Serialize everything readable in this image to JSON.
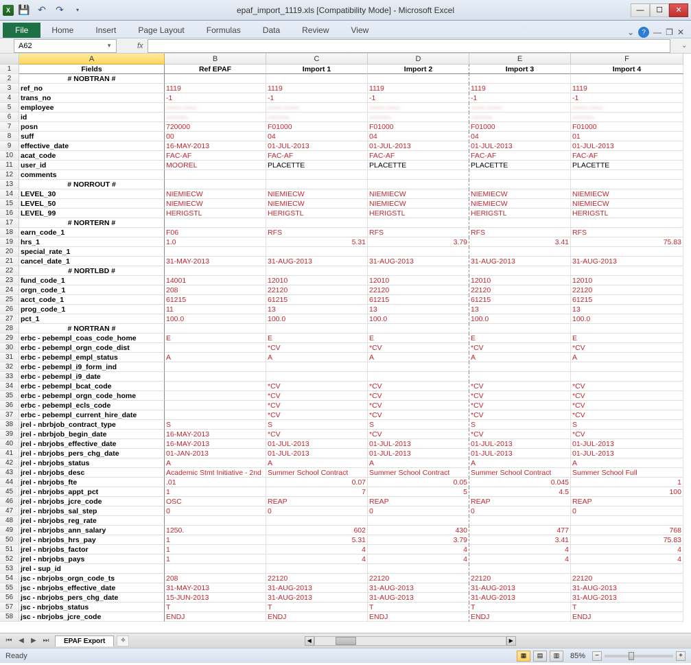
{
  "app": {
    "title": "epaf_import_1119.xls  [Compatibility Mode] - Microsoft Excel"
  },
  "ribbon": {
    "file": "File",
    "tabs": [
      "Home",
      "Insert",
      "Page Layout",
      "Formulas",
      "Data",
      "Review",
      "View"
    ]
  },
  "namebox": "A62",
  "fx": "fx",
  "cols": [
    "A",
    "B",
    "C",
    "D",
    "E",
    "F"
  ],
  "headers": [
    "Fields",
    "Ref EPAF",
    "Import 1",
    "Import 2",
    "Import 3",
    "Import 4"
  ],
  "rows": [
    {
      "n": 1,
      "type": "hdr",
      "c": [
        "Fields",
        "Ref EPAF",
        "Import 1",
        "Import 2",
        "Import 3",
        "Import 4"
      ]
    },
    {
      "n": 2,
      "type": "section",
      "c": [
        "# NOBTRAN #",
        "",
        "",
        "",
        "",
        ""
      ]
    },
    {
      "n": 3,
      "c": [
        "ref_no",
        "1119",
        "1119",
        "1119",
        "1119",
        "1119"
      ]
    },
    {
      "n": 4,
      "c": [
        "trans_no",
        "-1",
        "-1",
        "-1",
        "-1",
        "-1"
      ]
    },
    {
      "n": 5,
      "blur": true,
      "c": [
        "employee",
        "—— ——",
        "—— ——",
        "—— ——",
        "—— ——",
        "—— ——"
      ]
    },
    {
      "n": 6,
      "blur": true,
      "c": [
        "id",
        "———",
        "———",
        "———",
        "———",
        "———"
      ]
    },
    {
      "n": 7,
      "c": [
        "posn",
        "720000",
        "F01000",
        "F01000",
        "F01000",
        "F01000"
      ]
    },
    {
      "n": 8,
      "c": [
        "suff",
        "00",
        "04",
        "04",
        "04",
        "01"
      ]
    },
    {
      "n": 9,
      "c": [
        "effective_date",
        "16-MAY-2013",
        "01-JUL-2013",
        "01-JUL-2013",
        "01-JUL-2013",
        "01-JUL-2013"
      ]
    },
    {
      "n": 10,
      "c": [
        "acat_code",
        "FAC-AF",
        "FAC-AF",
        "FAC-AF",
        "FAC-AF",
        "FAC-AF"
      ]
    },
    {
      "n": 11,
      "c": [
        "user_id",
        "MOOREL",
        "PLACETTE",
        "PLACETTE",
        "PLACETTE",
        "PLACETTE"
      ],
      "black": [
        2,
        3,
        4,
        5
      ]
    },
    {
      "n": 12,
      "c": [
        "comments",
        "",
        "",
        "",
        "",
        ""
      ]
    },
    {
      "n": 13,
      "type": "section",
      "c": [
        "# NORROUT #",
        "",
        "",
        "",
        "",
        ""
      ]
    },
    {
      "n": 14,
      "c": [
        "LEVEL_30",
        "NIEMIECW",
        "NIEMIECW",
        "NIEMIECW",
        "NIEMIECW",
        "NIEMIECW"
      ]
    },
    {
      "n": 15,
      "c": [
        "LEVEL_50",
        "NIEMIECW",
        "NIEMIECW",
        "NIEMIECW",
        "NIEMIECW",
        "NIEMIECW"
      ]
    },
    {
      "n": 16,
      "c": [
        "LEVEL_99",
        "HERIGSTL",
        "HERIGSTL",
        "HERIGSTL",
        "HERIGSTL",
        "HERIGSTL"
      ]
    },
    {
      "n": 17,
      "type": "section",
      "c": [
        "# NORTERN #",
        "",
        "",
        "",
        "",
        ""
      ]
    },
    {
      "n": 18,
      "c": [
        "earn_code_1",
        "F06",
        "RFS",
        "RFS",
        "RFS",
        "RFS"
      ]
    },
    {
      "n": 19,
      "c": [
        "hrs_1",
        "1.0",
        "5.31",
        "3.79",
        "3.41",
        "75.83"
      ],
      "num": [
        2,
        3,
        4,
        5
      ]
    },
    {
      "n": 20,
      "c": [
        "special_rate_1",
        "",
        "",
        "",
        "",
        ""
      ]
    },
    {
      "n": 21,
      "c": [
        "cancel_date_1",
        "31-MAY-2013",
        "31-AUG-2013",
        "31-AUG-2013",
        "31-AUG-2013",
        "31-AUG-2013"
      ]
    },
    {
      "n": 22,
      "type": "section",
      "c": [
        "# NORTLBD #",
        "",
        "",
        "",
        "",
        ""
      ]
    },
    {
      "n": 23,
      "c": [
        "fund_code_1",
        "14001",
        "12010",
        "12010",
        "12010",
        "12010"
      ]
    },
    {
      "n": 24,
      "c": [
        "orgn_code_1",
        "208",
        "22120",
        "22120",
        "22120",
        "22120"
      ]
    },
    {
      "n": 25,
      "c": [
        "acct_code_1",
        "61215",
        "61215",
        "61215",
        "61215",
        "61215"
      ]
    },
    {
      "n": 26,
      "c": [
        "prog_code_1",
        "11",
        "13",
        "13",
        "13",
        "13"
      ]
    },
    {
      "n": 27,
      "c": [
        "pct_1",
        "100.0",
        "100.0",
        "100.0",
        "100.0",
        "100.0"
      ]
    },
    {
      "n": 28,
      "type": "section",
      "c": [
        "# NORTRAN #",
        "",
        "",
        "",
        "",
        ""
      ]
    },
    {
      "n": 29,
      "c": [
        "erbc - pebempl_coas_code_home",
        "E",
        "E",
        "E",
        "E",
        "E"
      ]
    },
    {
      "n": 30,
      "c": [
        "erbc - pebempl_orgn_code_dist",
        "",
        "*CV",
        "*CV",
        "*CV",
        "*CV"
      ]
    },
    {
      "n": 31,
      "c": [
        "erbc - pebempl_empl_status",
        "A",
        "A",
        "A",
        "A",
        "A"
      ]
    },
    {
      "n": 32,
      "c": [
        "erbc - pebempl_i9_form_ind",
        "",
        "",
        "",
        "",
        ""
      ]
    },
    {
      "n": 33,
      "c": [
        "erbc - pebempl_i9_date",
        "",
        "",
        "",
        "",
        ""
      ]
    },
    {
      "n": 34,
      "c": [
        "erbc - pebempl_bcat_code",
        "",
        "*CV",
        "*CV",
        "*CV",
        "*CV"
      ]
    },
    {
      "n": 35,
      "c": [
        "erbc - pebempl_orgn_code_home",
        "",
        "*CV",
        "*CV",
        "*CV",
        "*CV"
      ]
    },
    {
      "n": 36,
      "c": [
        "erbc - pebempl_ecls_code",
        "",
        "*CV",
        "*CV",
        "*CV",
        "*CV"
      ]
    },
    {
      "n": 37,
      "c": [
        "erbc - pebempl_current_hire_date",
        "",
        "*CV",
        "*CV",
        "*CV",
        "*CV"
      ]
    },
    {
      "n": 38,
      "c": [
        "jrel - nbrbjob_contract_type",
        "S",
        "S",
        "S",
        "S",
        "S"
      ]
    },
    {
      "n": 39,
      "c": [
        "jrel - nbrbjob_begin_date",
        "16-MAY-2013",
        "*CV",
        "*CV",
        "*CV",
        "*CV"
      ]
    },
    {
      "n": 40,
      "c": [
        "jrel - nbrjobs_effective_date",
        "16-MAY-2013",
        "01-JUL-2013",
        "01-JUL-2013",
        "01-JUL-2013",
        "01-JUL-2013"
      ]
    },
    {
      "n": 41,
      "c": [
        "jrel - nbrjobs_pers_chg_date",
        "01-JAN-2013",
        "01-JUL-2013",
        "01-JUL-2013",
        "01-JUL-2013",
        "01-JUL-2013"
      ]
    },
    {
      "n": 42,
      "c": [
        "jrel - nbrjobs_status",
        "A",
        "A",
        "A",
        "A",
        "A"
      ]
    },
    {
      "n": 43,
      "c": [
        "jrel - nbrjobs_desc",
        "Academic Stmt Initiative - 2nd",
        "Summer School Contract",
        "Summer School Contract",
        "Summer School Contract",
        "Summer School Full"
      ]
    },
    {
      "n": 44,
      "c": [
        "jrel - nbrjobs_fte",
        ".01",
        "0.07",
        "0.05",
        "0.045",
        "1"
      ],
      "num": [
        2,
        3,
        4,
        5
      ]
    },
    {
      "n": 45,
      "c": [
        "jrel - nbrjobs_appt_pct",
        "1",
        "7",
        "5",
        "4.5",
        "100"
      ],
      "num": [
        2,
        3,
        4,
        5
      ]
    },
    {
      "n": 46,
      "c": [
        "jrel - nbrjobs_jcre_code",
        "OSC",
        "REAP",
        "REAP",
        "REAP",
        "REAP"
      ]
    },
    {
      "n": 47,
      "c": [
        "jrel - nbrjobs_sal_step",
        "0",
        "0",
        "0",
        "0",
        "0"
      ]
    },
    {
      "n": 48,
      "c": [
        "jrel - nbrjobs_reg_rate",
        "",
        "",
        "",
        "",
        ""
      ]
    },
    {
      "n": 49,
      "c": [
        "jrel - nbrjobs_ann_salary",
        "1250.",
        "602",
        "430",
        "477",
        "768"
      ],
      "num": [
        2,
        3,
        4,
        5
      ]
    },
    {
      "n": 50,
      "c": [
        "jrel - nbrjobs_hrs_pay",
        "1",
        "5.31",
        "3.79",
        "3.41",
        "75.83"
      ],
      "num": [
        2,
        3,
        4,
        5
      ]
    },
    {
      "n": 51,
      "c": [
        "jrel - nbrjobs_factor",
        "1",
        "4",
        "4",
        "4",
        "4"
      ],
      "num": [
        2,
        3,
        4,
        5
      ]
    },
    {
      "n": 52,
      "c": [
        "jrel - nbrjobs_pays",
        "1",
        "4",
        "4",
        "4",
        "4"
      ],
      "num": [
        2,
        3,
        4,
        5
      ]
    },
    {
      "n": 53,
      "c": [
        "jrel - sup_id",
        "",
        "",
        "",
        "",
        ""
      ]
    },
    {
      "n": 54,
      "c": [
        "jsc - nbrjobs_orgn_code_ts",
        "208",
        "22120",
        "22120",
        "22120",
        "22120"
      ]
    },
    {
      "n": 55,
      "c": [
        "jsc - nbrjobs_effective_date",
        "31-MAY-2013",
        "31-AUG-2013",
        "31-AUG-2013",
        "31-AUG-2013",
        "31-AUG-2013"
      ]
    },
    {
      "n": 56,
      "c": [
        "jsc - nbrjobs_pers_chg_date",
        "15-JUN-2013",
        "31-AUG-2013",
        "31-AUG-2013",
        "31-AUG-2013",
        "31-AUG-2013"
      ]
    },
    {
      "n": 57,
      "c": [
        "jsc - nbrjobs_status",
        "T",
        "T",
        "T",
        "T",
        "T"
      ]
    },
    {
      "n": 58,
      "c": [
        "jsc - nbrjobs_jcre_code",
        "ENDJ",
        "ENDJ",
        "ENDJ",
        "ENDJ",
        "ENDJ"
      ]
    }
  ],
  "sheet": {
    "name": "EPAF Export"
  },
  "status": {
    "ready": "Ready",
    "zoom": "85%"
  }
}
